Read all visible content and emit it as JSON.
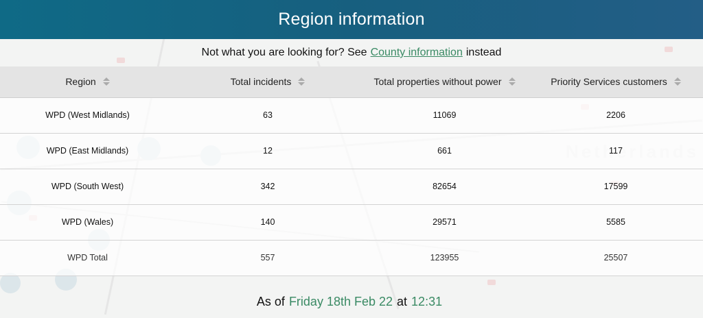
{
  "header": {
    "title": "Region information"
  },
  "subtitle": {
    "prefix": "Not what you are looking for? See",
    "link_label": "County information",
    "suffix": "instead"
  },
  "table": {
    "columns": [
      "Region",
      "Total incidents",
      "Total properties without power",
      "Priority Services customers"
    ],
    "rows": [
      {
        "region": "WPD (West Midlands)",
        "incidents": "63",
        "properties": "11069",
        "priority": "2206"
      },
      {
        "region": "WPD (East Midlands)",
        "incidents": "12",
        "properties": "661",
        "priority": "117"
      },
      {
        "region": "WPD (South West)",
        "incidents": "342",
        "properties": "82654",
        "priority": "17599"
      },
      {
        "region": "WPD (Wales)",
        "incidents": "140",
        "properties": "29571",
        "priority": "5585"
      }
    ],
    "total": {
      "region": "WPD Total",
      "incidents": "557",
      "properties": "123955",
      "priority": "25507"
    }
  },
  "footer": {
    "prefix": "As of",
    "date": "Friday 18th Feb 22",
    "at": "at",
    "time": "12:31"
  },
  "colors": {
    "header_start": "#0f6a86",
    "header_end": "#235e86",
    "accent_green": "#3a8a64"
  }
}
